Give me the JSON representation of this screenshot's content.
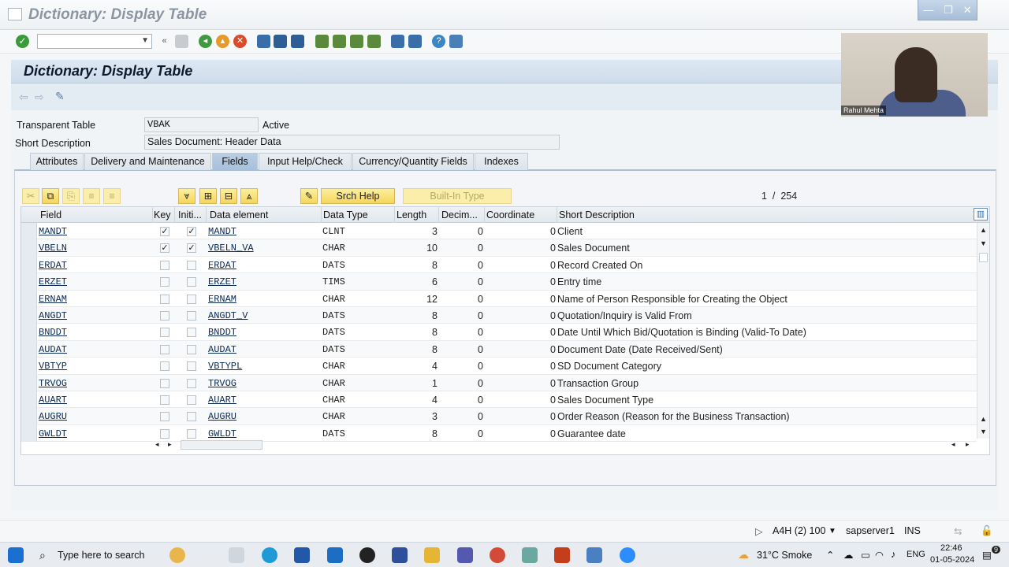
{
  "window": {
    "title": "Dictionary: Display Table",
    "controls": [
      "—",
      "❐",
      "✕"
    ]
  },
  "screen": {
    "title": "Dictionary: Display Table"
  },
  "form": {
    "transparent_table_label": "Transparent Table",
    "transparent_table_value": "VBAK",
    "status": "Active",
    "short_description_label": "Short Description",
    "short_description_value": "Sales Document: Header Data"
  },
  "tabs": [
    {
      "label": "Attributes",
      "active": false
    },
    {
      "label": "Delivery and Maintenance",
      "active": false
    },
    {
      "label": "Fields",
      "active": true
    },
    {
      "label": "Input Help/Check",
      "active": false
    },
    {
      "label": "Currency/Quantity Fields",
      "active": false
    },
    {
      "label": "Indexes",
      "active": false
    }
  ],
  "table_toolbar": {
    "srch_help": "Srch Help",
    "built_in_type": "Built-In Type",
    "page": "1",
    "separator": "/",
    "total": "254"
  },
  "columns": [
    "Field",
    "Key",
    "Initi...",
    "Data element",
    "Data Type",
    "Length",
    "Decim...",
    "Coordinate",
    "Short Description"
  ],
  "rows": [
    {
      "field": "MANDT",
      "key": true,
      "init": true,
      "element": "MANDT",
      "type": "CLNT",
      "length": "3",
      "dec": "0",
      "coord": "0",
      "desc": "Client"
    },
    {
      "field": "VBELN",
      "key": true,
      "init": true,
      "element": "VBELN_VA",
      "type": "CHAR",
      "length": "10",
      "dec": "0",
      "coord": "0",
      "desc": "Sales Document"
    },
    {
      "field": "ERDAT",
      "key": false,
      "init": false,
      "element": "ERDAT",
      "type": "DATS",
      "length": "8",
      "dec": "0",
      "coord": "0",
      "desc": "Record Created On"
    },
    {
      "field": "ERZET",
      "key": false,
      "init": false,
      "element": "ERZET",
      "type": "TIMS",
      "length": "6",
      "dec": "0",
      "coord": "0",
      "desc": "Entry time"
    },
    {
      "field": "ERNAM",
      "key": false,
      "init": false,
      "element": "ERNAM",
      "type": "CHAR",
      "length": "12",
      "dec": "0",
      "coord": "0",
      "desc": "Name of Person Responsible for Creating the Object"
    },
    {
      "field": "ANGDT",
      "key": false,
      "init": false,
      "element": "ANGDT_V",
      "type": "DATS",
      "length": "8",
      "dec": "0",
      "coord": "0",
      "desc": "Quotation/Inquiry is Valid From"
    },
    {
      "field": "BNDDT",
      "key": false,
      "init": false,
      "element": "BNDDT",
      "type": "DATS",
      "length": "8",
      "dec": "0",
      "coord": "0",
      "desc": "Date Until Which Bid/Quotation is Binding (Valid-To Date)"
    },
    {
      "field": "AUDAT",
      "key": false,
      "init": false,
      "element": "AUDAT",
      "type": "DATS",
      "length": "8",
      "dec": "0",
      "coord": "0",
      "desc": "Document Date (Date Received/Sent)"
    },
    {
      "field": "VBTYP",
      "key": false,
      "init": false,
      "element": "VBTYPL",
      "type": "CHAR",
      "length": "4",
      "dec": "0",
      "coord": "0",
      "desc": "SD Document Category"
    },
    {
      "field": "TRVOG",
      "key": false,
      "init": false,
      "element": "TRVOG",
      "type": "CHAR",
      "length": "1",
      "dec": "0",
      "coord": "0",
      "desc": "Transaction Group"
    },
    {
      "field": "AUART",
      "key": false,
      "init": false,
      "element": "AUART",
      "type": "CHAR",
      "length": "4",
      "dec": "0",
      "coord": "0",
      "desc": "Sales Document Type"
    },
    {
      "field": "AUGRU",
      "key": false,
      "init": false,
      "element": "AUGRU",
      "type": "CHAR",
      "length": "3",
      "dec": "0",
      "coord": "0",
      "desc": "Order Reason (Reason for the Business Transaction)"
    },
    {
      "field": "GWLDT",
      "key": false,
      "init": false,
      "element": "GWLDT",
      "type": "DATS",
      "length": "8",
      "dec": "0",
      "coord": "0",
      "desc": "Guarantee date"
    }
  ],
  "webcam": {
    "name": "Rahul Mehta"
  },
  "status": {
    "system": "A4H (2) 100",
    "server": "sapserver1",
    "mode": "INS"
  },
  "taskbar": {
    "search_placeholder": "Type here to search",
    "weather": "31°C Smoke",
    "language": "ENG",
    "time": "22:46",
    "date": "01-05-2024",
    "notifications": "9"
  },
  "colors": {
    "accent": "#a7c0dc",
    "button_yellow": "#f5d65a",
    "check_green": "#3a9b3a"
  }
}
